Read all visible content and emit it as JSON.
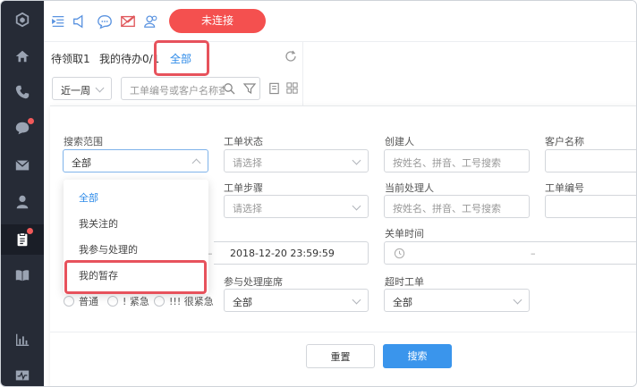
{
  "topbar": {
    "connect_label": "未连接"
  },
  "tabs": [
    {
      "label": "待领取1"
    },
    {
      "label": "我的待办0/1"
    },
    {
      "label": "全部"
    }
  ],
  "filters": {
    "period": "近一周",
    "search_placeholder": "工单编号或客户名称查询"
  },
  "form": {
    "search_scope": {
      "label": "搜索范围",
      "value": "全部"
    },
    "ticket_status": {
      "label": "工单状态",
      "placeholder": "请选择"
    },
    "creator": {
      "label": "创建人",
      "placeholder": "按姓名、拼音、工号搜索"
    },
    "customer_name": {
      "label": "客户名称"
    },
    "ticket_step": {
      "label": "工单步骤",
      "placeholder": "请选择"
    },
    "current_handler": {
      "label": "当前处理人",
      "placeholder": "按姓名、拼音、工号搜索"
    },
    "ticket_number": {
      "label": "工单编号"
    },
    "create_end_time": "2018-12-20 23:59:59",
    "close_time": {
      "label": "关单时间",
      "separator": "–"
    },
    "seat": {
      "label": "参与处理座席",
      "value": "全部"
    },
    "timeout": {
      "label": "超时工单",
      "value": "全部"
    },
    "priority": [
      "普通",
      "! 紧急",
      "!!! 很紧急"
    ]
  },
  "scope_options": [
    "全部",
    "我关注的",
    "我参与处理的",
    "我的暂存"
  ],
  "buttons": {
    "reset": "重置",
    "search": "搜索"
  },
  "colors": {
    "accent": "#2c8ae8",
    "danger": "#f4504f",
    "sidebar": "#262b36"
  }
}
